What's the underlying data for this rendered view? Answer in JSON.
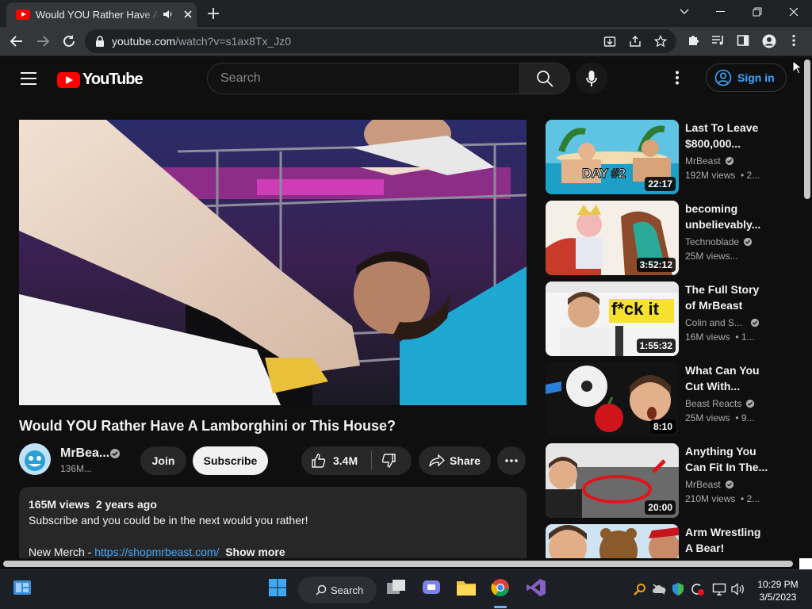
{
  "browser": {
    "tab_title": "Would YOU Rather Have A Lamborghini or This House?",
    "url_host": "youtube.com",
    "url_path": "/watch?v=s1ax8Tx_Jz0"
  },
  "header": {
    "logo_text": "YouTube",
    "search_placeholder": "Search",
    "signin_label": "Sign in"
  },
  "video": {
    "title": "Would YOU Rather Have A Lamborghini or This House?",
    "channel": "MrBea...",
    "subscribers": "136M...",
    "join_label": "Join",
    "subscribe_label": "Subscribe",
    "likes": "3.4M",
    "share_label": "Share"
  },
  "description": {
    "stats": "165M views  2 years ago",
    "line1": "Subscribe and you could be in the next would you rather!",
    "line2_prefix": "New Merch - ",
    "line2_link": "https://shopmrbeast.com/",
    "show_more": "Show more"
  },
  "recommendations": [
    {
      "title1": "Last To Leave",
      "title2": "$800,000...",
      "channel": "MrBeast",
      "verified": true,
      "meta": "192M views  • 2...",
      "duration": "22:17",
      "thumb_text": "DAY #2"
    },
    {
      "title1": "becoming",
      "title2": "unbelievably...",
      "channel": "Technoblade",
      "verified": true,
      "meta": "25M views...",
      "duration": "3:52:12"
    },
    {
      "title1": "The Full Story",
      "title2": "of MrBeast",
      "channel": "Colin and S...",
      "verified": true,
      "meta": "16M views  • 1...",
      "duration": "1:55:32",
      "thumb_text": "f*ck it"
    },
    {
      "title1": "What Can You",
      "title2": "Cut With...",
      "channel": "Beast Reacts",
      "verified": true,
      "meta": "25M views  • 9...",
      "duration": "8:10"
    },
    {
      "title1": "Anything You",
      "title2": "Can Fit In The...",
      "channel": "MrBeast",
      "verified": true,
      "meta": "210M views  • 2...",
      "duration": "20:00"
    },
    {
      "title1": "Arm Wrestling",
      "title2": "A Bear!",
      "channel": "",
      "verified": false,
      "meta": "",
      "duration": ""
    }
  ],
  "taskbar": {
    "search_label": "Search",
    "time": "10:29 PM",
    "date": "3/5/2023"
  },
  "colors": {
    "background": "#0f0f0f",
    "accent_link": "#3ea6ff",
    "youtube_red": "#ff0000"
  }
}
